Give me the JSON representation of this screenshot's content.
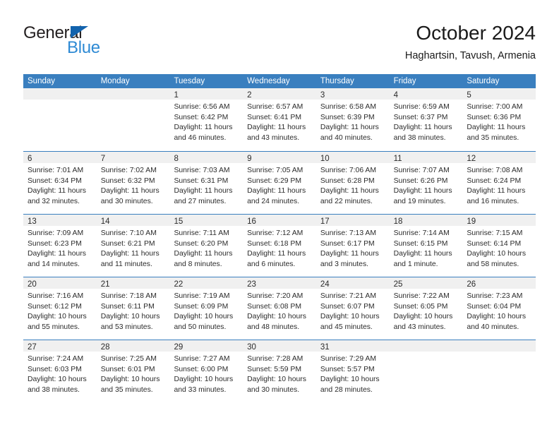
{
  "brand": {
    "name_dark": "General",
    "name_blue": "Blue",
    "triangle_color": "#1263ad",
    "blue_color": "#2e8ad4"
  },
  "header": {
    "title": "October 2024",
    "subtitle": "Haghartsin, Tavush, Armenia"
  },
  "theme": {
    "header_blue": "#3a7fbf",
    "day_strip_gray": "#f0f0f0",
    "text": "#2b2b2b"
  },
  "weekdays": [
    "Sunday",
    "Monday",
    "Tuesday",
    "Wednesday",
    "Thursday",
    "Friday",
    "Saturday"
  ],
  "weeks": [
    [
      {
        "day": "",
        "lines": []
      },
      {
        "day": "",
        "lines": []
      },
      {
        "day": "1",
        "lines": [
          "Sunrise: 6:56 AM",
          "Sunset: 6:42 PM",
          "Daylight: 11 hours",
          "and 46 minutes."
        ]
      },
      {
        "day": "2",
        "lines": [
          "Sunrise: 6:57 AM",
          "Sunset: 6:41 PM",
          "Daylight: 11 hours",
          "and 43 minutes."
        ]
      },
      {
        "day": "3",
        "lines": [
          "Sunrise: 6:58 AM",
          "Sunset: 6:39 PM",
          "Daylight: 11 hours",
          "and 40 minutes."
        ]
      },
      {
        "day": "4",
        "lines": [
          "Sunrise: 6:59 AM",
          "Sunset: 6:37 PM",
          "Daylight: 11 hours",
          "and 38 minutes."
        ]
      },
      {
        "day": "5",
        "lines": [
          "Sunrise: 7:00 AM",
          "Sunset: 6:36 PM",
          "Daylight: 11 hours",
          "and 35 minutes."
        ]
      }
    ],
    [
      {
        "day": "6",
        "lines": [
          "Sunrise: 7:01 AM",
          "Sunset: 6:34 PM",
          "Daylight: 11 hours",
          "and 32 minutes."
        ]
      },
      {
        "day": "7",
        "lines": [
          "Sunrise: 7:02 AM",
          "Sunset: 6:32 PM",
          "Daylight: 11 hours",
          "and 30 minutes."
        ]
      },
      {
        "day": "8",
        "lines": [
          "Sunrise: 7:03 AM",
          "Sunset: 6:31 PM",
          "Daylight: 11 hours",
          "and 27 minutes."
        ]
      },
      {
        "day": "9",
        "lines": [
          "Sunrise: 7:05 AM",
          "Sunset: 6:29 PM",
          "Daylight: 11 hours",
          "and 24 minutes."
        ]
      },
      {
        "day": "10",
        "lines": [
          "Sunrise: 7:06 AM",
          "Sunset: 6:28 PM",
          "Daylight: 11 hours",
          "and 22 minutes."
        ]
      },
      {
        "day": "11",
        "lines": [
          "Sunrise: 7:07 AM",
          "Sunset: 6:26 PM",
          "Daylight: 11 hours",
          "and 19 minutes."
        ]
      },
      {
        "day": "12",
        "lines": [
          "Sunrise: 7:08 AM",
          "Sunset: 6:24 PM",
          "Daylight: 11 hours",
          "and 16 minutes."
        ]
      }
    ],
    [
      {
        "day": "13",
        "lines": [
          "Sunrise: 7:09 AM",
          "Sunset: 6:23 PM",
          "Daylight: 11 hours",
          "and 14 minutes."
        ]
      },
      {
        "day": "14",
        "lines": [
          "Sunrise: 7:10 AM",
          "Sunset: 6:21 PM",
          "Daylight: 11 hours",
          "and 11 minutes."
        ]
      },
      {
        "day": "15",
        "lines": [
          "Sunrise: 7:11 AM",
          "Sunset: 6:20 PM",
          "Daylight: 11 hours",
          "and 8 minutes."
        ]
      },
      {
        "day": "16",
        "lines": [
          "Sunrise: 7:12 AM",
          "Sunset: 6:18 PM",
          "Daylight: 11 hours",
          "and 6 minutes."
        ]
      },
      {
        "day": "17",
        "lines": [
          "Sunrise: 7:13 AM",
          "Sunset: 6:17 PM",
          "Daylight: 11 hours",
          "and 3 minutes."
        ]
      },
      {
        "day": "18",
        "lines": [
          "Sunrise: 7:14 AM",
          "Sunset: 6:15 PM",
          "Daylight: 11 hours",
          "and 1 minute."
        ]
      },
      {
        "day": "19",
        "lines": [
          "Sunrise: 7:15 AM",
          "Sunset: 6:14 PM",
          "Daylight: 10 hours",
          "and 58 minutes."
        ]
      }
    ],
    [
      {
        "day": "20",
        "lines": [
          "Sunrise: 7:16 AM",
          "Sunset: 6:12 PM",
          "Daylight: 10 hours",
          "and 55 minutes."
        ]
      },
      {
        "day": "21",
        "lines": [
          "Sunrise: 7:18 AM",
          "Sunset: 6:11 PM",
          "Daylight: 10 hours",
          "and 53 minutes."
        ]
      },
      {
        "day": "22",
        "lines": [
          "Sunrise: 7:19 AM",
          "Sunset: 6:09 PM",
          "Daylight: 10 hours",
          "and 50 minutes."
        ]
      },
      {
        "day": "23",
        "lines": [
          "Sunrise: 7:20 AM",
          "Sunset: 6:08 PM",
          "Daylight: 10 hours",
          "and 48 minutes."
        ]
      },
      {
        "day": "24",
        "lines": [
          "Sunrise: 7:21 AM",
          "Sunset: 6:07 PM",
          "Daylight: 10 hours",
          "and 45 minutes."
        ]
      },
      {
        "day": "25",
        "lines": [
          "Sunrise: 7:22 AM",
          "Sunset: 6:05 PM",
          "Daylight: 10 hours",
          "and 43 minutes."
        ]
      },
      {
        "day": "26",
        "lines": [
          "Sunrise: 7:23 AM",
          "Sunset: 6:04 PM",
          "Daylight: 10 hours",
          "and 40 minutes."
        ]
      }
    ],
    [
      {
        "day": "27",
        "lines": [
          "Sunrise: 7:24 AM",
          "Sunset: 6:03 PM",
          "Daylight: 10 hours",
          "and 38 minutes."
        ]
      },
      {
        "day": "28",
        "lines": [
          "Sunrise: 7:25 AM",
          "Sunset: 6:01 PM",
          "Daylight: 10 hours",
          "and 35 minutes."
        ]
      },
      {
        "day": "29",
        "lines": [
          "Sunrise: 7:27 AM",
          "Sunset: 6:00 PM",
          "Daylight: 10 hours",
          "and 33 minutes."
        ]
      },
      {
        "day": "30",
        "lines": [
          "Sunrise: 7:28 AM",
          "Sunset: 5:59 PM",
          "Daylight: 10 hours",
          "and 30 minutes."
        ]
      },
      {
        "day": "31",
        "lines": [
          "Sunrise: 7:29 AM",
          "Sunset: 5:57 PM",
          "Daylight: 10 hours",
          "and 28 minutes."
        ]
      },
      {
        "day": "",
        "lines": []
      },
      {
        "day": "",
        "lines": []
      }
    ]
  ]
}
